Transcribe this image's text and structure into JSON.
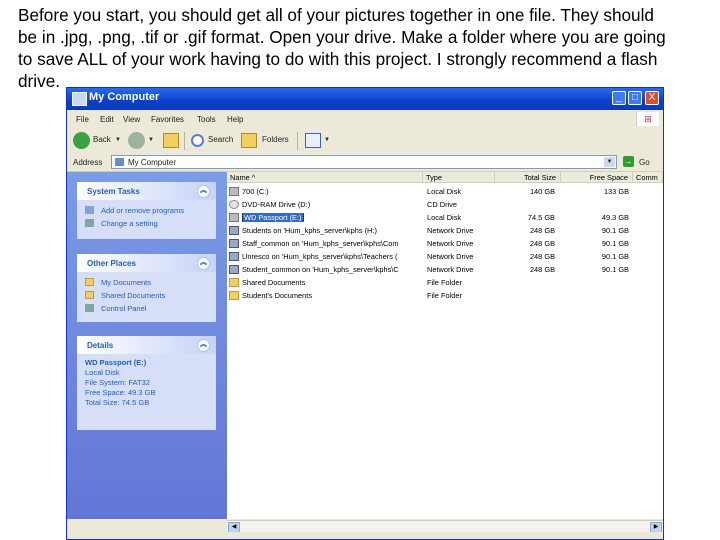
{
  "caption": {
    "line1": "Before you start, you should get all of your pictures together in one file.  They should",
    "line2": "be in .jpg, .png, .tif or .gif format.  Open your drive.  Make a folder where you are going",
    "line3": "to save ALL of your work having to do with this project.  I strongly recommend a flash",
    "line4": "drive."
  },
  "window": {
    "title": "My Computer",
    "controls": {
      "minimize": "_",
      "maximize": "□",
      "close": "X"
    }
  },
  "menu": [
    "File",
    "Edit",
    "View",
    "Favorites",
    "Tools",
    "Help"
  ],
  "toolbar": {
    "back": "Back",
    "search": "Search",
    "folders": "Folders"
  },
  "address": {
    "label": "Address",
    "value": "My Computer",
    "go": "Go"
  },
  "tasks": {
    "title": "System Tasks",
    "items": [
      "Add or remove programs",
      "Change a setting"
    ]
  },
  "places": {
    "title": "Other Places",
    "items": [
      "My Documents",
      "Shared Documents",
      "Control Panel"
    ]
  },
  "details": {
    "title": "Details",
    "name": "WD Passport (E:)",
    "type": "Local Disk",
    "fs": "File System: FAT32",
    "free": "Free Space: 49.3 GB",
    "total": "Total Size: 74.5 GB"
  },
  "columns": [
    "Name",
    "Type",
    "Total Size",
    "Free Space",
    "Comm"
  ],
  "files": [
    {
      "name": "700 (C:)",
      "type": "Local Disk",
      "total": "140 GB",
      "free": "133 GB",
      "icon": "drive"
    },
    {
      "name": "DVD-RAM Drive (D:)",
      "type": "CD Drive",
      "total": "",
      "free": "",
      "icon": "cd"
    },
    {
      "name": "WD Passport (E:)",
      "type": "Local Disk",
      "total": "74.5 GB",
      "free": "49.3 GB",
      "icon": "drive"
    },
    {
      "name": "Students on 'Hum_kphs_server\\kphs (H:)",
      "type": "Network Drive",
      "total": "248 GB",
      "free": "90.1 GB",
      "icon": "net"
    },
    {
      "name": "Staff_common on 'Hum_kphs_server\\kphs\\Com",
      "type": "Network Drive",
      "total": "248 GB",
      "free": "90.1 GB",
      "icon": "net"
    },
    {
      "name": "Unresco on 'Hum_kphs_server\\kphs\\Teachers (",
      "type": "Network Drive",
      "total": "248 GB",
      "free": "90.1 GB",
      "icon": "net"
    },
    {
      "name": "Student_common on 'Hum_kphs_server\\kphs\\C",
      "type": "Network Drive",
      "total": "248 GB",
      "free": "90.1 GB",
      "icon": "net"
    },
    {
      "name": "Shared Documents",
      "type": "File Folder",
      "total": "",
      "free": "",
      "icon": "folder"
    },
    {
      "name": "Student's Documents",
      "type": "File Folder",
      "total": "",
      "free": "",
      "icon": "folder"
    }
  ],
  "colors": {
    "titlebar": "#0a3fc9",
    "taskpane": "#6375d6",
    "link": "#215dc6"
  }
}
